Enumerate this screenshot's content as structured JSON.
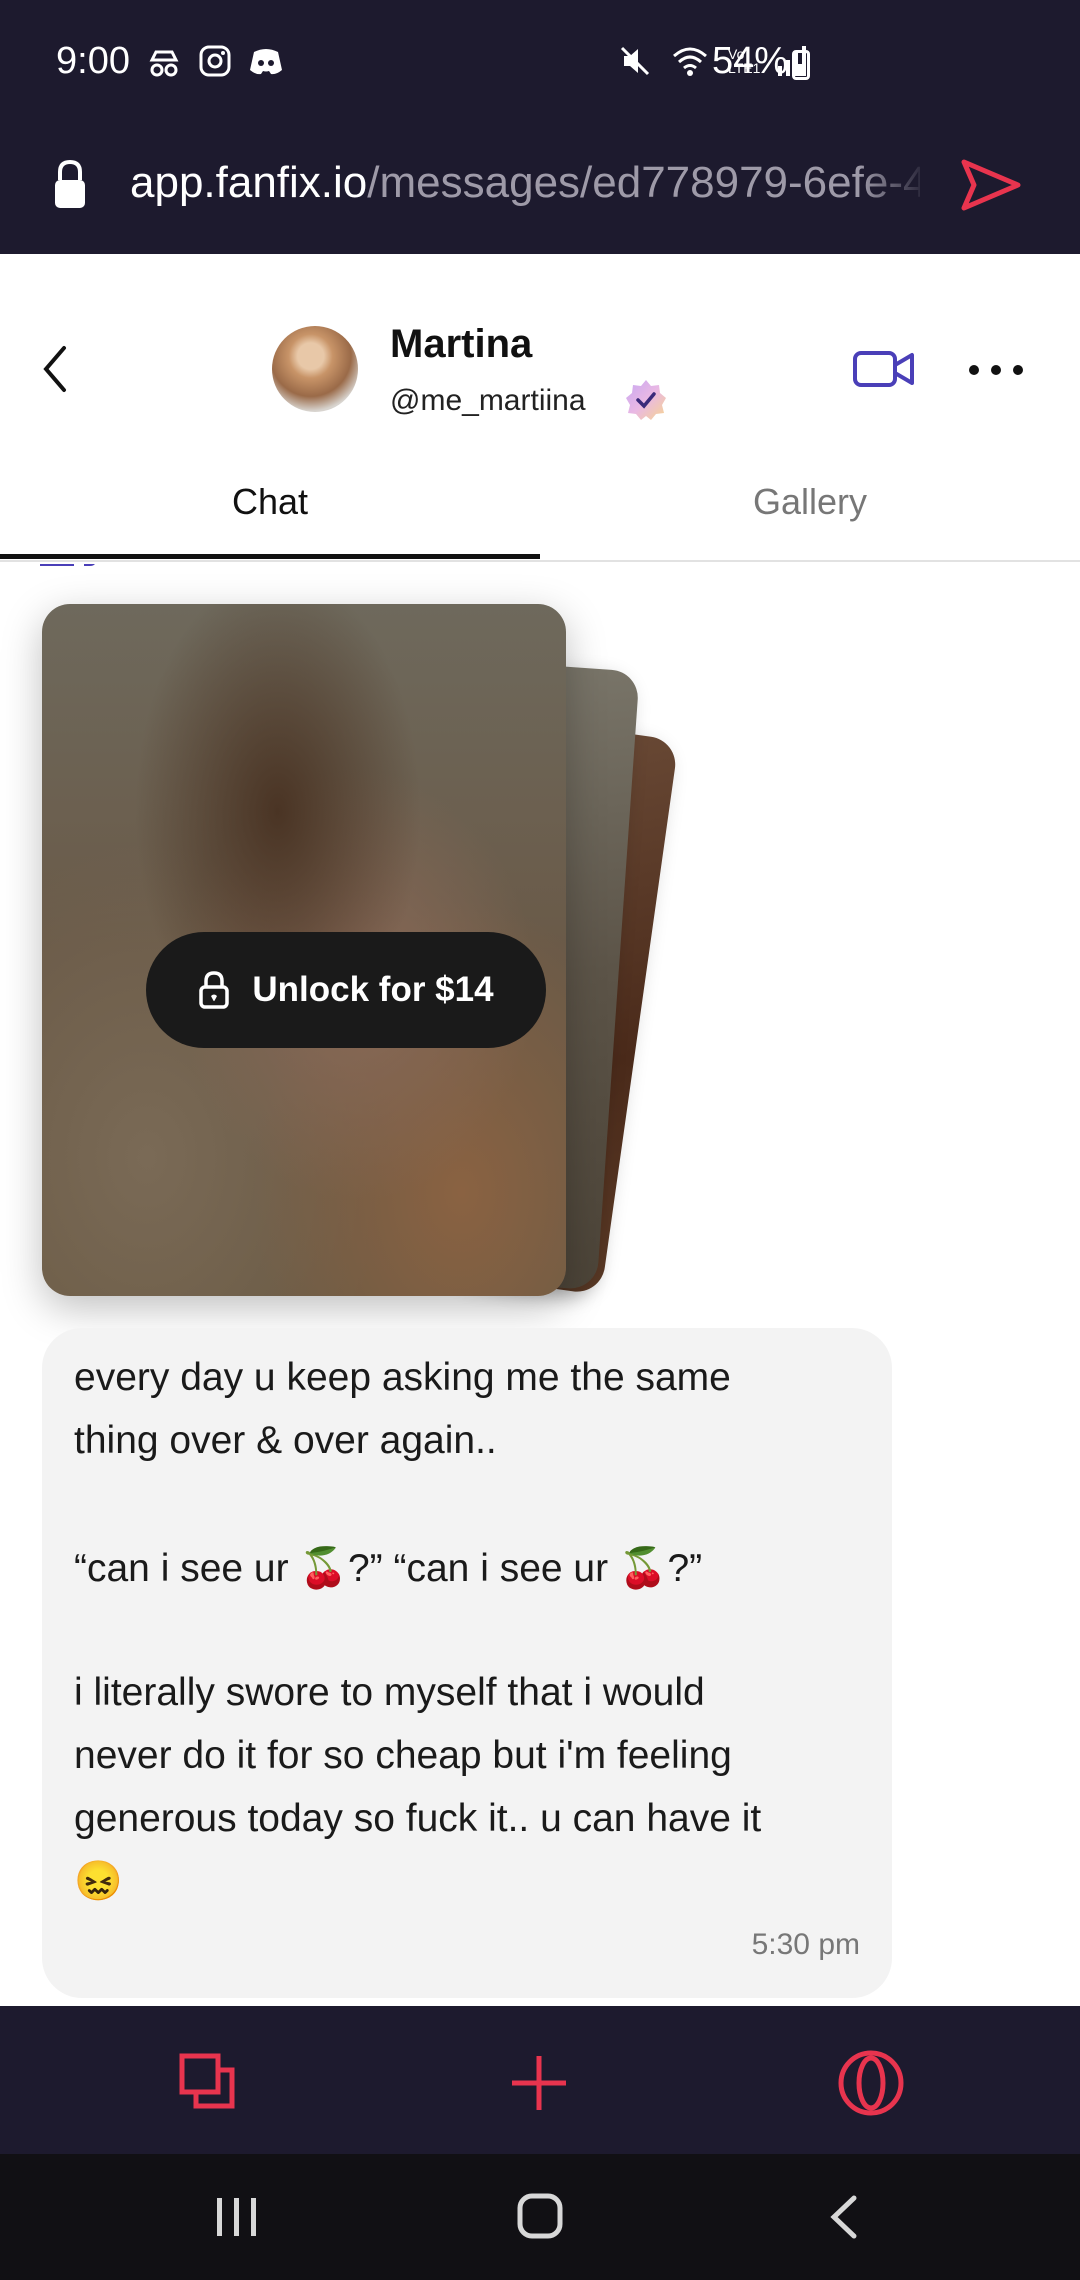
{
  "status_bar": {
    "time": "9:00",
    "battery": "54%",
    "icons_left": [
      "incognito-icon",
      "instagram-icon",
      "discord-icon"
    ],
    "icons_right": [
      "mute-icon",
      "wifi-icon",
      "volte-icon",
      "signal-icon",
      "battery-icon"
    ],
    "volte_label": "Vo LTE1"
  },
  "browser": {
    "url_domain": "app.fanfix.io",
    "url_path": "/messages/ed778979-6efe-4",
    "accent_color": "#e8344e"
  },
  "header": {
    "name": "Martina",
    "handle": "@me_martiina",
    "accent_color": "#4a3fb8"
  },
  "tabs": [
    {
      "label": "Chat",
      "active": true
    },
    {
      "label": "Gallery",
      "active": false
    }
  ],
  "locked_media": {
    "unlock_label": "Unlock for $14"
  },
  "message": {
    "lines": [
      "every day u keep asking me the same",
      "thing over & over again..",
      "“can i see ur 🍒?” “can i see ur 🍒?”",
      "i literally swore to myself that i would",
      "never do it for so cheap but i'm feeling",
      "generous today so fuck it.. u can have it",
      "😖"
    ],
    "time": "5:30 pm"
  }
}
